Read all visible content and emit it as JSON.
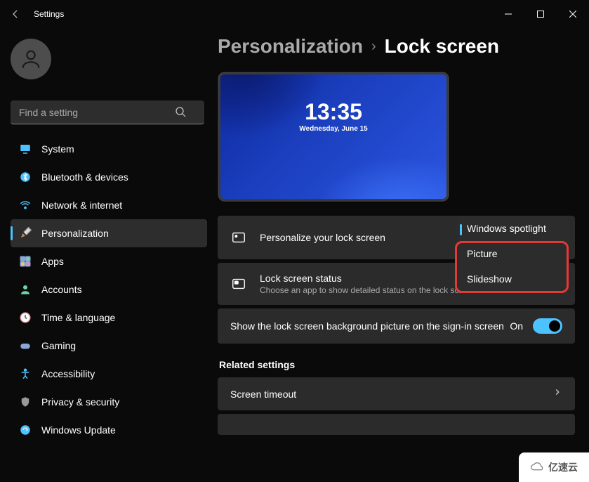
{
  "app_title": "Settings",
  "search": {
    "placeholder": "Find a setting"
  },
  "nav": [
    {
      "label": "System",
      "icon": "monitor",
      "color": "#4cc2ff"
    },
    {
      "label": "Bluetooth & devices",
      "icon": "bluetooth",
      "color": "#4cc2ff"
    },
    {
      "label": "Network & internet",
      "icon": "wifi",
      "color": "#4cc2ff"
    },
    {
      "label": "Personalization",
      "icon": "brush",
      "color": "#e688c2",
      "active": true
    },
    {
      "label": "Apps",
      "icon": "apps",
      "color": "#8aa6d6"
    },
    {
      "label": "Accounts",
      "icon": "person",
      "color": "#6bd6a8"
    },
    {
      "label": "Time & language",
      "icon": "clock",
      "color": "#f2a0a0"
    },
    {
      "label": "Gaming",
      "icon": "gamepad",
      "color": "#8aa6d6"
    },
    {
      "label": "Accessibility",
      "icon": "accessibility",
      "color": "#4cc2ff"
    },
    {
      "label": "Privacy & security",
      "icon": "shield",
      "color": "#999"
    },
    {
      "label": "Windows Update",
      "icon": "update",
      "color": "#4cc2ff"
    }
  ],
  "breadcrumb": {
    "parent": "Personalization",
    "current": "Lock screen"
  },
  "preview": {
    "time": "13:35",
    "date": "Wednesday, June 15"
  },
  "cards": {
    "personalize": {
      "title": "Personalize your lock screen",
      "value": "Windows spotlight",
      "options": [
        "Windows spotlight",
        "Picture",
        "Slideshow"
      ]
    },
    "status": {
      "title": "Lock screen status",
      "sub": "Choose an app to show detailed status on the lock screen"
    },
    "signin_bg": {
      "title": "Show the lock screen background picture on the sign-in screen",
      "toggle_label": "On",
      "toggle_on": true
    }
  },
  "related": {
    "heading": "Related settings",
    "items": [
      {
        "title": "Screen timeout"
      }
    ]
  },
  "watermark": "亿速云"
}
